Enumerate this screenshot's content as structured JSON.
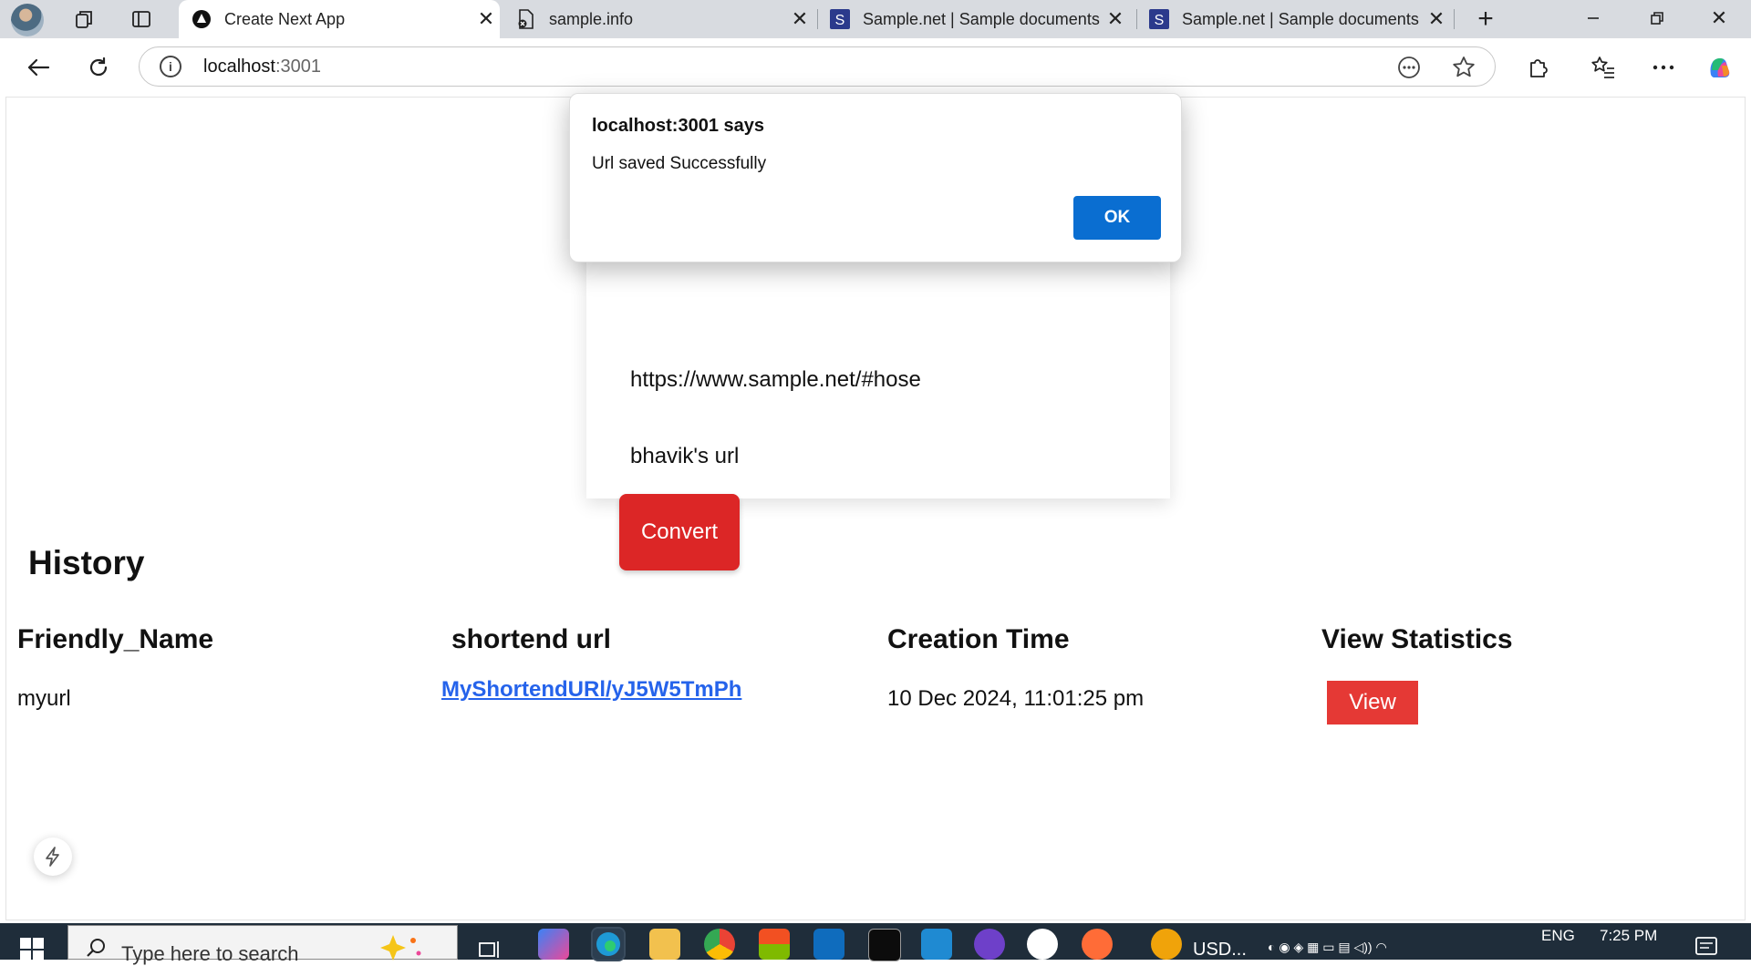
{
  "browser": {
    "tabs": [
      {
        "title": "Create Next App",
        "active": true
      },
      {
        "title": "sample.info",
        "active": false
      },
      {
        "title": "Sample.net | Sample documents",
        "active": false
      },
      {
        "title": "Sample.net | Sample documents",
        "active": false
      }
    ],
    "address": {
      "host": "localhost",
      "port": ":3001"
    }
  },
  "form": {
    "url_value": "https://www.sample.net/#hose",
    "name_value": "bhavik's url",
    "convert_label": "Convert"
  },
  "history": {
    "title": "History",
    "columns": [
      "Friendly_Name",
      "shortend url",
      "Creation Time",
      "View Statistics"
    ],
    "rows": [
      {
        "friendly_name": "myurl",
        "short_url": "MyShortendURl/yJ5W5TmPh",
        "created": "10 Dec 2024, 11:01:25 pm",
        "action": "View"
      }
    ]
  },
  "dialog": {
    "title": "localhost:3001 says",
    "message": "Url saved Successfully",
    "ok_label": "OK"
  },
  "taskbar": {
    "search_placeholder": "Type here to search",
    "app_label": "USD...",
    "language": "ENG",
    "time": "7:25 PM"
  },
  "colors": {
    "convert": "#dc2626",
    "view": "#e53935",
    "ok": "#0a6ed1",
    "link": "#2563eb"
  }
}
